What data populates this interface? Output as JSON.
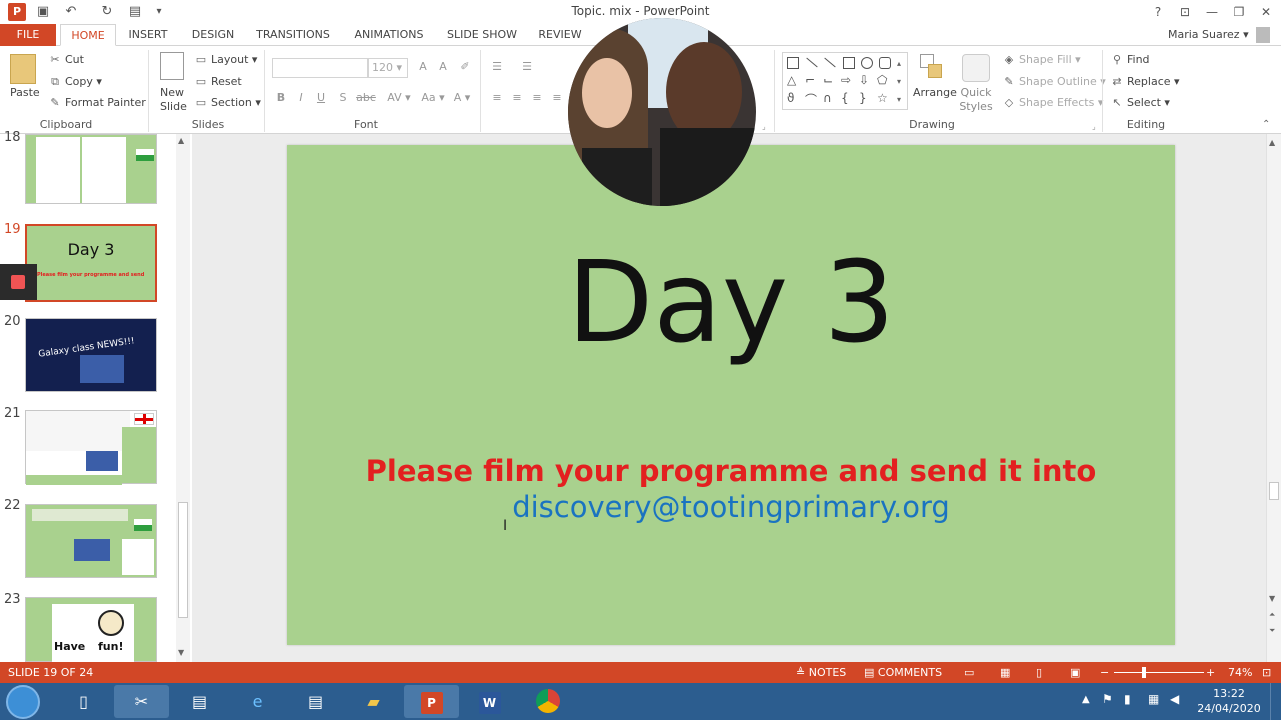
{
  "window": {
    "title": "Topic. mix - PowerPoint",
    "user": "Maria Suarez",
    "help_glyph": "?",
    "min_glyph": "—",
    "restore_glyph": "❐",
    "close_glyph": "✕"
  },
  "tabs": [
    "FILE",
    "HOME",
    "INSERT",
    "DESIGN",
    "TRANSITIONS",
    "ANIMATIONS",
    "SLIDE SHOW",
    "REVIEW"
  ],
  "ribbon": {
    "clipboard": {
      "label": "Clipboard",
      "paste": "Paste",
      "cut": "Cut",
      "copy": "Copy",
      "format_painter": "Format Painter"
    },
    "slides": {
      "label": "Slides",
      "new_slide_1": "New",
      "new_slide_2": "Slide",
      "layout": "Layout",
      "reset": "Reset",
      "section": "Section"
    },
    "font": {
      "label": "Font",
      "size": "120",
      "bold": "B",
      "italic": "I",
      "underline": "U",
      "shadow": "S",
      "strike": "abc",
      "spacing": "AV",
      "case": "Aa",
      "color": "A"
    },
    "drawing": {
      "label": "Drawing",
      "arrange": "Arrange",
      "quick_1": "Quick",
      "quick_2": "Styles",
      "shape_fill": "Shape Fill",
      "shape_outline": "Shape Outline",
      "shape_effects": "Shape Effects"
    },
    "editing": {
      "label": "Editing",
      "find": "Find",
      "replace": "Replace",
      "select": "Select"
    }
  },
  "thumbnails": [
    {
      "num": "18"
    },
    {
      "num": "19",
      "title": "Day 3",
      "line": "Please film your programme and send it into"
    },
    {
      "num": "20",
      "title": "Galaxy class NEWS!!!"
    },
    {
      "num": "21"
    },
    {
      "num": "22"
    },
    {
      "num": "23",
      "word1": "Have",
      "word2": "fun!"
    }
  ],
  "slide": {
    "title": "Day 3",
    "line1": "Please film your programme and send it into",
    "line2": "discovery@tootingprimary.org",
    "background": "#a9d18e",
    "accent_red": "#e32020",
    "accent_blue": "#1a73c1"
  },
  "status": {
    "slide_info": "SLIDE 19 OF 24",
    "notes": "NOTES",
    "comments": "COMMENTS",
    "zoom": "74%"
  },
  "taskbar": {
    "time": "13:22",
    "date": "24/04/2020"
  }
}
